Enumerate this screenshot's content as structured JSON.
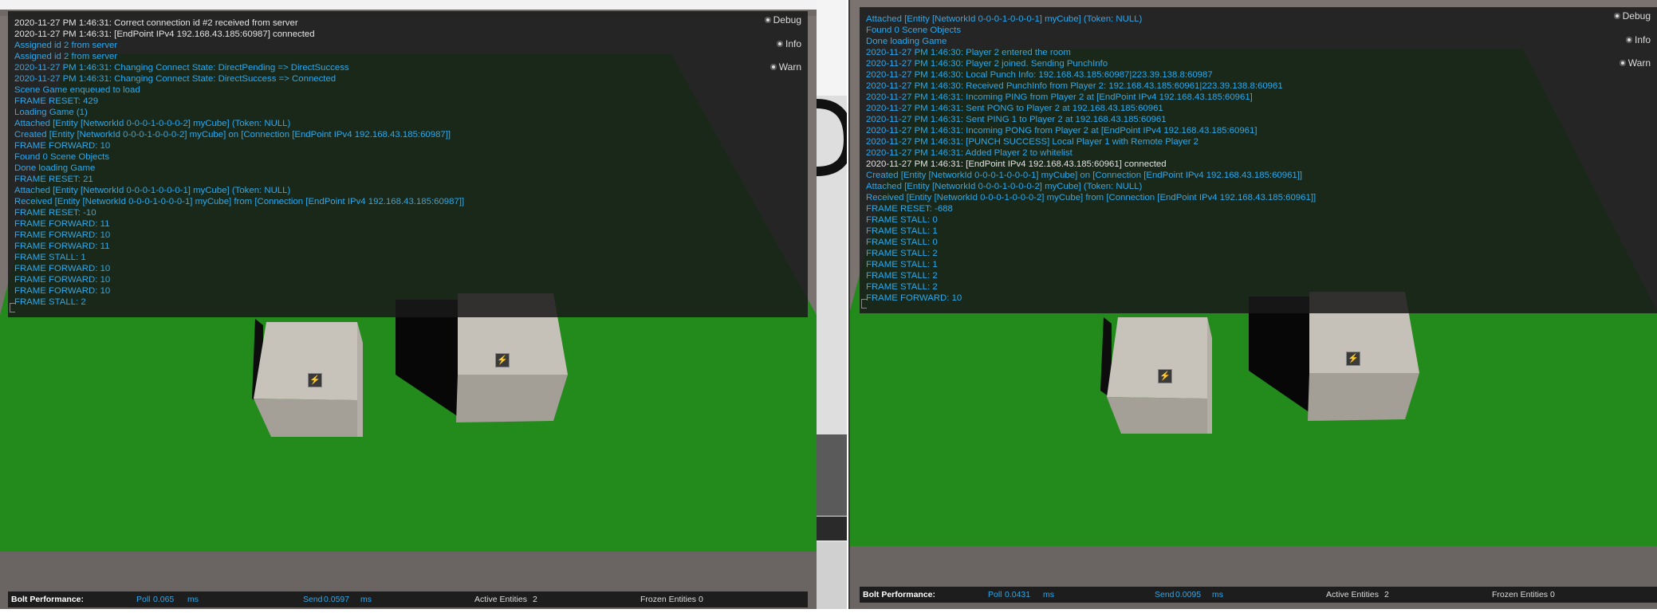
{
  "colors": {
    "ground": "#238a1c",
    "console_bg": "#1c1c1c",
    "debug_text": "#e4e4e4",
    "info_text": "#2aa9ee",
    "cube": "#c9c4bb"
  },
  "left": {
    "log": [
      {
        "level": "debug",
        "text": "2020-11-27 PM 1:46:31: Correct connection id #2 received from server"
      },
      {
        "level": "debug",
        "text": "2020-11-27 PM 1:46:31: [EndPoint IPv4 192.168.43.185:60987] connected"
      },
      {
        "level": "info",
        "text": "Assigned id 2 from server"
      },
      {
        "level": "info",
        "text": "Assigned id 2 from server"
      },
      {
        "level": "info",
        "text": "2020-11-27 PM 1:46:31: Changing Connect State: DirectPending => DirectSuccess"
      },
      {
        "level": "info",
        "text": "2020-11-27 PM 1:46:31: Changing Connect State: DirectSuccess => Connected"
      },
      {
        "level": "info",
        "text": "Scene Game enqueued to load"
      },
      {
        "level": "info",
        "text": "FRAME RESET: 429"
      },
      {
        "level": "info",
        "text": "Loading Game (1)"
      },
      {
        "level": "info",
        "text": "Attached [Entity [NetworkId 0-0-0-1-0-0-0-2] myCube] (Token: NULL)"
      },
      {
        "level": "info",
        "text": "Created [Entity [NetworkId 0-0-0-1-0-0-0-2] myCube] on [Connection [EndPoint IPv4 192.168.43.185:60987]]"
      },
      {
        "level": "info",
        "text": "FRAME FORWARD: 10"
      },
      {
        "level": "info",
        "text": "Found 0 Scene Objects"
      },
      {
        "level": "info",
        "text": "Done loading Game"
      },
      {
        "level": "info",
        "text": "FRAME RESET: 21"
      },
      {
        "level": "info",
        "text": "Attached [Entity [NetworkId 0-0-0-1-0-0-0-1] myCube] (Token: NULL)"
      },
      {
        "level": "info",
        "text": "Received [Entity [NetworkId 0-0-0-1-0-0-0-1] myCube] from [Connection [EndPoint IPv4 192.168.43.185:60987]]"
      },
      {
        "level": "info",
        "text": "FRAME RESET: -10"
      },
      {
        "level": "info",
        "text": "FRAME FORWARD: 11"
      },
      {
        "level": "info",
        "text": "FRAME FORWARD: 10"
      },
      {
        "level": "info",
        "text": "FRAME FORWARD: 11"
      },
      {
        "level": "info",
        "text": "FRAME STALL: 1"
      },
      {
        "level": "info",
        "text": "FRAME FORWARD: 10"
      },
      {
        "level": "info",
        "text": "FRAME FORWARD: 10"
      },
      {
        "level": "info",
        "text": "FRAME FORWARD: 10"
      },
      {
        "level": "info",
        "text": "FRAME STALL: 2"
      }
    ],
    "filters": {
      "debug": "Debug",
      "info": "Info",
      "warn": "Warn"
    },
    "perf": {
      "title": "Bolt Performance:",
      "poll_label": "Poll",
      "poll_value": "0.065",
      "poll_unit": "ms",
      "send_label": "Send",
      "send_value": "0.0597",
      "send_unit": "ms",
      "active_label": "Active Entities",
      "active_value": "2",
      "frozen_label": "Frozen Entities",
      "frozen_value": "0"
    }
  },
  "right": {
    "log": [
      {
        "level": "info",
        "text": "Attached [Entity [NetworkId 0-0-0-1-0-0-0-1] myCube] (Token: NULL)"
      },
      {
        "level": "info",
        "text": "Found 0 Scene Objects"
      },
      {
        "level": "info",
        "text": "Done loading Game"
      },
      {
        "level": "info",
        "text": "2020-11-27 PM 1:46:30: Player 2 entered the room"
      },
      {
        "level": "info",
        "text": "2020-11-27 PM 1:46:30: Player 2 joined. Sending PunchInfo"
      },
      {
        "level": "info",
        "text": "2020-11-27 PM 1:46:30: Local Punch Info: 192.168.43.185:60987|223.39.138.8:60987"
      },
      {
        "level": "info",
        "text": "2020-11-27 PM 1:46:30: Received PunchInfo from Player 2: 192.168.43.185:60961|223.39.138.8:60961"
      },
      {
        "level": "info",
        "text": "2020-11-27 PM 1:46:31: Incoming PING from Player 2 at [EndPoint IPv4 192.168.43.185:60961]"
      },
      {
        "level": "info",
        "text": "2020-11-27 PM 1:46:31: Sent PONG to Player 2 at 192.168.43.185:60961"
      },
      {
        "level": "info",
        "text": "2020-11-27 PM 1:46:31: Sent PING 1 to Player 2 at 192.168.43.185:60961"
      },
      {
        "level": "info",
        "text": "2020-11-27 PM 1:46:31: Incoming PONG from Player 2 at [EndPoint IPv4 192.168.43.185:60961]"
      },
      {
        "level": "info",
        "text": "2020-11-27 PM 1:46:31: [PUNCH SUCCESS] Local Player 1 with Remote Player 2"
      },
      {
        "level": "info",
        "text": "2020-11-27 PM 1:46:31: Added Player 2 to whitelist"
      },
      {
        "level": "debug",
        "text": "2020-11-27 PM 1:46:31: [EndPoint IPv4 192.168.43.185:60961] connected"
      },
      {
        "level": "info",
        "text": "Created [Entity [NetworkId 0-0-0-1-0-0-0-1] myCube] on [Connection [EndPoint IPv4 192.168.43.185:60961]]"
      },
      {
        "level": "info",
        "text": "Attached [Entity [NetworkId 0-0-0-1-0-0-0-2] myCube] (Token: NULL)"
      },
      {
        "level": "info",
        "text": "Received [Entity [NetworkId 0-0-0-1-0-0-0-2] myCube] from [Connection [EndPoint IPv4 192.168.43.185:60961]]"
      },
      {
        "level": "info",
        "text": "FRAME RESET: -688"
      },
      {
        "level": "info",
        "text": "FRAME STALL: 0"
      },
      {
        "level": "info",
        "text": "FRAME STALL: 1"
      },
      {
        "level": "info",
        "text": "FRAME STALL: 0"
      },
      {
        "level": "info",
        "text": "FRAME STALL: 2"
      },
      {
        "level": "info",
        "text": "FRAME STALL: 1"
      },
      {
        "level": "info",
        "text": "FRAME STALL: 2"
      },
      {
        "level": "info",
        "text": "FRAME STALL: 2"
      },
      {
        "level": "info",
        "text": "FRAME FORWARD: 10"
      }
    ],
    "filters": {
      "debug": "Debug",
      "info": "Info",
      "warn": "Warn"
    },
    "perf": {
      "title": "Bolt Performance:",
      "poll_label": "Poll",
      "poll_value": "0.0431",
      "poll_unit": "ms",
      "send_label": "Send",
      "send_value": "0.0095",
      "send_unit": "ms",
      "active_label": "Active Entities",
      "active_value": "2",
      "frozen_label": "Frozen Entities",
      "frozen_value": "0"
    }
  },
  "icons": {
    "cube_logo": "bolt-icon"
  },
  "bolt_glyph": "⚡"
}
